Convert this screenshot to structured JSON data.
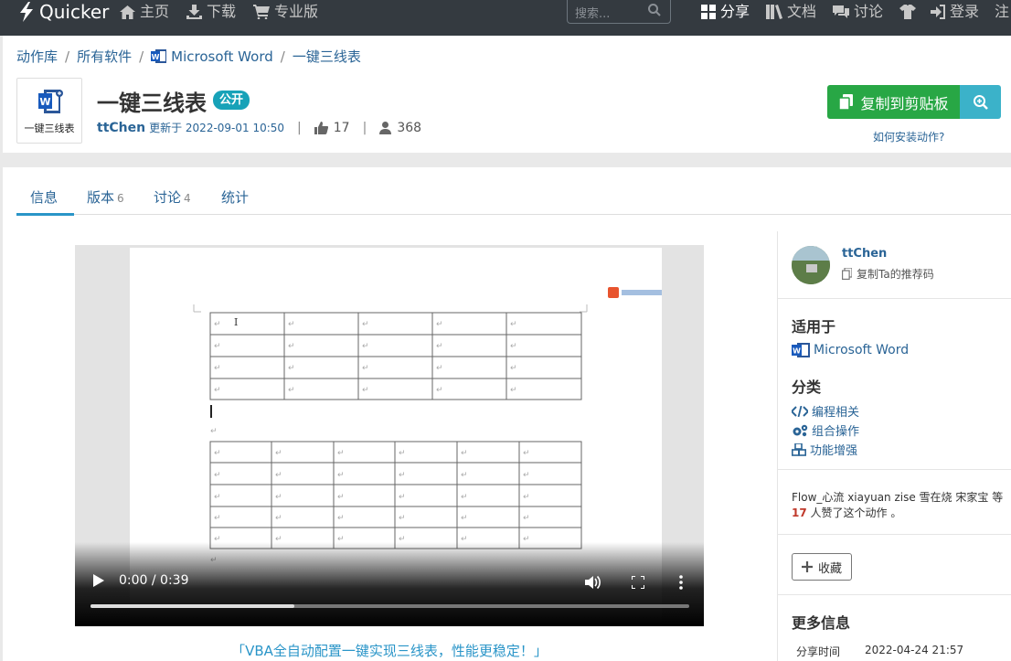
{
  "nav": {
    "brand": "Quicker",
    "home": "主页",
    "download": "下载",
    "pro": "专业版",
    "search_placeholder": "搜索...",
    "share": "分享",
    "docs": "文档",
    "discuss": "讨论",
    "login": "登录",
    "register": "注"
  },
  "breadcrumb": {
    "items": [
      "动作库",
      "所有软件",
      "Microsoft Word",
      "一键三线表"
    ]
  },
  "action": {
    "icon_label": "一键三线表",
    "title": "一键三线表",
    "badge": "公开",
    "author": "ttChen",
    "updated": "更新于 2022-09-01 10:50",
    "likes": "17",
    "users": "368",
    "copy_button": "复制到剪贴板",
    "how_to_install": "如何安装动作?"
  },
  "tabs": [
    {
      "label": "信息",
      "count": ""
    },
    {
      "label": "版本",
      "count": "6"
    },
    {
      "label": "讨论",
      "count": "4"
    },
    {
      "label": "统计",
      "count": ""
    }
  ],
  "video": {
    "time": "0:00 / 0:39",
    "progress": 0.34
  },
  "caption": "「VBA全自动配置一键实现三线表，性能更稳定！」",
  "sidebar": {
    "author": "ttChen",
    "copy_ref": "复制Ta的推荐码",
    "applies_heading": "适用于",
    "applies_app": "Microsoft Word",
    "category_heading": "分类",
    "categories": [
      "编程相关",
      "组合操作",
      "功能增强"
    ],
    "likers_text": "Flow_心流 xiayuan zise 雪在烧 宋家宝 等",
    "likers_count": "17",
    "likers_suffix": "人赞了这个动作 。",
    "favorite": "收藏",
    "more_heading": "更多信息",
    "share_time_label": "分享时间",
    "share_time": "2022-04-24 21:57"
  },
  "colors": {
    "topbar": "#343a40",
    "link": "#2a6496",
    "green": "#28a745",
    "teal": "#17a2b8"
  }
}
